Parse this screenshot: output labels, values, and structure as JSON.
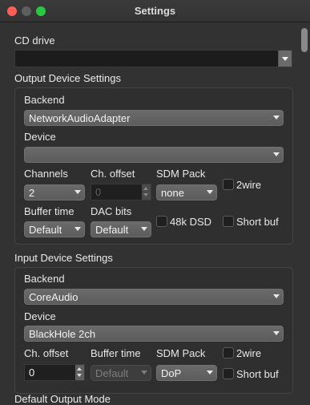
{
  "window": {
    "title": "Settings"
  },
  "cd_drive": {
    "label": "CD drive",
    "value": ""
  },
  "output": {
    "section_title": "Output Device Settings",
    "backend_label": "Backend",
    "backend_value": "NetworkAudioAdapter",
    "device_label": "Device",
    "device_value": "",
    "channels_label": "Channels",
    "channels_value": "2",
    "ch_offset_label": "Ch. offset",
    "ch_offset_value": "0",
    "sdm_pack_label": "SDM Pack",
    "sdm_pack_value": "none",
    "twowire_label": "2wire",
    "buffer_time_label": "Buffer time",
    "buffer_time_value": "Default",
    "dac_bits_label": "DAC bits",
    "dac_bits_value": "Default",
    "dsd48k_label": "48k DSD",
    "short_buf_label": "Short buf"
  },
  "input": {
    "section_title": "Input Device Settings",
    "backend_label": "Backend",
    "backend_value": "CoreAudio",
    "device_label": "Device",
    "device_value": "BlackHole 2ch",
    "ch_offset_label": "Ch. offset",
    "ch_offset_value": "0",
    "buffer_time_label": "Buffer time",
    "buffer_time_value": "Default",
    "sdm_pack_label": "SDM Pack",
    "sdm_pack_value": "DoP",
    "twowire_label": "2wire",
    "short_buf_label": "Short buf"
  },
  "next_section": {
    "title": "Default Output Mode"
  }
}
